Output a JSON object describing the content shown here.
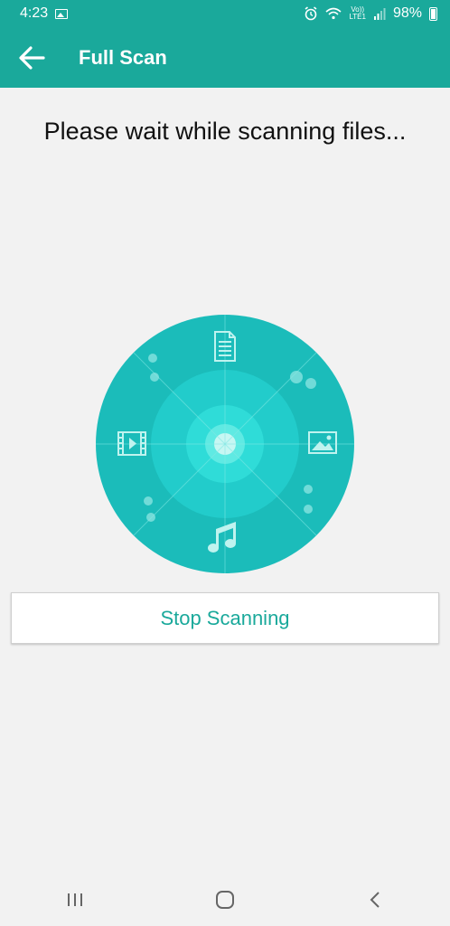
{
  "status_bar": {
    "time": "4:23",
    "network_top": "Vo))",
    "network_bottom": "LTE1",
    "battery": "98%"
  },
  "app_bar": {
    "title": "Full Scan"
  },
  "message": "Please wait while scanning files...",
  "stop_button_label": "Stop Scanning",
  "colors": {
    "primary": "#1aa99b",
    "radar_outer": "#1bbcba",
    "radar_mid": "#22cccb",
    "radar_inner": "#2fdcd8",
    "radar_core": "#5feae3",
    "background": "#f2f2f2"
  },
  "radar_icons": [
    "document-icon",
    "image-icon",
    "music-icon",
    "video-icon"
  ]
}
